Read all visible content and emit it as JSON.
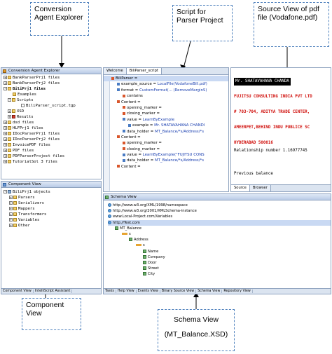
{
  "callouts": {
    "explorer": "Conversion Agent Explorer",
    "script": "Script for Parser Project",
    "source": "Source View of pdf file (Vodafone.pdf)",
    "component": "Component View",
    "schema_title": "Schema View",
    "schema_sub": "(MT_Balance.XSD)"
  },
  "explorer": {
    "title": "Conversion Agent Explorer",
    "rows": [
      {
        "label": "BankParserPrj1 files",
        "indent": 0,
        "icon": "folder",
        "sign": "+"
      },
      {
        "label": "BankParserPrj2 files",
        "indent": 0,
        "icon": "folder",
        "sign": "+"
      },
      {
        "label": "BiliPrj1 files",
        "indent": 0,
        "icon": "folder",
        "sign": "-"
      },
      {
        "label": "Examples",
        "indent": 1,
        "icon": "folder",
        "sign": ""
      },
      {
        "label": "Scripts",
        "indent": 1,
        "icon": "folder",
        "sign": "-"
      },
      {
        "label": "BiliParser_script.tgp",
        "indent": 3,
        "icon": "file",
        "sign": ""
      },
      {
        "label": "XSD",
        "indent": 1,
        "icon": "folder",
        "sign": "+"
      },
      {
        "label": "Results",
        "indent": 1,
        "icon": "red",
        "sign": "+"
      },
      {
        "label": "dsd files",
        "indent": 0,
        "icon": "folder",
        "sign": "+"
      },
      {
        "label": "HLFPrj1 files",
        "indent": 0,
        "icon": "folder",
        "sign": "+"
      },
      {
        "label": "IDocParserPrj1 files",
        "indent": 0,
        "icon": "folder",
        "sign": "+"
      },
      {
        "label": "IDocParserPrj2 files",
        "indent": 0,
        "icon": "folder",
        "sign": "+"
      },
      {
        "label": "InvoicePDF files",
        "indent": 0,
        "icon": "folder",
        "sign": "+"
      },
      {
        "label": "PDF files",
        "indent": 0,
        "icon": "folder",
        "sign": "+"
      },
      {
        "label": "PDFParserProject files",
        "indent": 0,
        "icon": "folder",
        "sign": "+"
      },
      {
        "label": "TutorialSol 3 files",
        "indent": 0,
        "icon": "folder",
        "sign": "+"
      }
    ]
  },
  "component": {
    "title": "Component View",
    "rows": [
      {
        "label": "BiliPrj1 objects",
        "indent": 0,
        "icon": "db",
        "sign": "-"
      },
      {
        "label": "Parsers",
        "indent": 1,
        "icon": "folder",
        "sign": "+"
      },
      {
        "label": "Serializers",
        "indent": 1,
        "icon": "folder",
        "sign": "+"
      },
      {
        "label": "Mappers",
        "indent": 1,
        "icon": "folder",
        "sign": "+"
      },
      {
        "label": "Transformers",
        "indent": 1,
        "icon": "folder",
        "sign": "+"
      },
      {
        "label": "Variables",
        "indent": 1,
        "icon": "folder",
        "sign": "+"
      },
      {
        "label": "Other",
        "indent": 1,
        "icon": "folder",
        "sign": "+"
      }
    ],
    "bottom_tabs": [
      "Component View",
      "IntelliScript Assistant"
    ]
  },
  "editor": {
    "tabs": [
      "Welcome",
      "BiliParser_script"
    ],
    "rows": [
      {
        "text": "BiliParser =",
        "indent": 0,
        "hl": true,
        "val": ""
      },
      {
        "text": "example_source = ",
        "indent": 1,
        "hl": false,
        "val": "LocalFile(VodafoneBill.pdf)"
      },
      {
        "text": "format = ",
        "indent": 1,
        "hl": false,
        "val": "CustomFormat(... (RemoveMarginS)"
      },
      {
        "text": "contains",
        "indent": 2,
        "hl": false,
        "val": ""
      },
      {
        "text": "Content =",
        "indent": 1,
        "hl": false,
        "val": ""
      },
      {
        "text": "opening_marker =",
        "indent": 2,
        "hl": false,
        "val": ""
      },
      {
        "text": "closing_marker =",
        "indent": 2,
        "hl": false,
        "val": ""
      },
      {
        "text": "value = ",
        "indent": 2,
        "hl": false,
        "val": "LearnByExample"
      },
      {
        "text": "example = ",
        "indent": 3,
        "hl": false,
        "val": "Mr. SHATAVAHANA CHANDI"
      },
      {
        "text": "data_holder = ",
        "indent": 2,
        "hl": false,
        "val": "MT_Balance/*s/Address/*s"
      },
      {
        "text": "Content =",
        "indent": 1,
        "hl": false,
        "val": ""
      },
      {
        "text": "opening_marker =",
        "indent": 2,
        "hl": false,
        "val": ""
      },
      {
        "text": "closing_marker =",
        "indent": 2,
        "hl": false,
        "val": ""
      },
      {
        "text": "value = ",
        "indent": 2,
        "hl": false,
        "val": "LearnByExample(\"FUJITSU CONS"
      },
      {
        "text": "data_holder = ",
        "indent": 2,
        "hl": false,
        "val": "MT_Balance/*s/Address/*s"
      },
      {
        "text": "Content =",
        "indent": 1,
        "hl": false,
        "val": ""
      }
    ]
  },
  "source_view": {
    "lines": [
      {
        "text": "Mr. SHATAVAHANA CHANDA",
        "style": "hl"
      },
      {
        "text": "",
        "style": ""
      },
      {
        "text": "FUJITSU CONSULTING INDIA PVT LTD",
        "style": "red"
      },
      {
        "text": "",
        "style": ""
      },
      {
        "text": "# 703-704, ADITYA TRADE CENTER,",
        "style": "red"
      },
      {
        "text": "",
        "style": ""
      },
      {
        "text": "AMEERPET,BEHIND INDU PUBLICE SC",
        "style": "red"
      },
      {
        "text": "",
        "style": ""
      },
      {
        "text": "HYDERABAD 500016",
        "style": "red"
      },
      {
        "text": "Relationship number 1.16977745",
        "style": ""
      },
      {
        "text": "",
        "style": ""
      },
      {
        "text": "",
        "style": ""
      },
      {
        "text": "Previous balance",
        "style": ""
      }
    ],
    "tabs": [
      "Source",
      "Browser"
    ]
  },
  "schema": {
    "title": "Schema View",
    "rows": [
      {
        "label": "http://www.w3.org/XML/1998/namespace",
        "indent": 0,
        "icon": "g"
      },
      {
        "label": "http://www.w3.org/2001/XMLSchema-instance",
        "indent": 0,
        "icon": "g"
      },
      {
        "label": "www.Local-Project.com/Variables",
        "indent": 0,
        "icon": "g"
      },
      {
        "label": "http://Test.com",
        "indent": 0,
        "icon": "g",
        "hl": true
      },
      {
        "label": "MT_Balance",
        "indent": 1,
        "icon": "e"
      },
      {
        "label": "s",
        "indent": 2,
        "icon": "s"
      },
      {
        "label": "Address",
        "indent": 3,
        "icon": "e"
      },
      {
        "label": "s",
        "indent": 4,
        "icon": "s"
      },
      {
        "label": "Name",
        "indent": 5,
        "icon": "e"
      },
      {
        "label": "Company",
        "indent": 5,
        "icon": "e"
      },
      {
        "label": "Door",
        "indent": 5,
        "icon": "e"
      },
      {
        "label": "Street",
        "indent": 5,
        "icon": "e"
      },
      {
        "label": "City",
        "indent": 5,
        "icon": "e"
      }
    ],
    "bottom_tabs": [
      "Tasks",
      "Help View",
      "Events View",
      "Binary Source View",
      "Schema View",
      "Repository View"
    ]
  }
}
